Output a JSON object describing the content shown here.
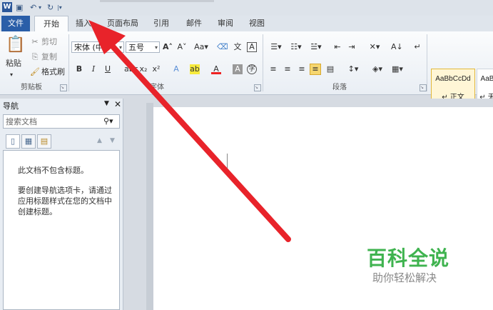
{
  "quick_access": {
    "word_icon": "word-logo",
    "save_icon": "save-icon",
    "undo": "↶",
    "redo": "↻"
  },
  "tabs": [
    {
      "label": "文件"
    },
    {
      "label": "开始"
    },
    {
      "label": "插入"
    },
    {
      "label": "页面布局"
    },
    {
      "label": "引用"
    },
    {
      "label": "邮件"
    },
    {
      "label": "审阅"
    },
    {
      "label": "视图"
    }
  ],
  "clipboard": {
    "paste": "粘贴",
    "cut": "剪切",
    "copy": "复制",
    "format_painter": "格式刷",
    "group": "剪贴板"
  },
  "font": {
    "name": "宋体 (中",
    "size": "五号",
    "group": "字体"
  },
  "paragraph": {
    "group": "段落"
  },
  "styles": {
    "normal_sample": "AaBbCcDd",
    "normal_name": "正文",
    "next_sample": "AaB",
    "next_name": "无"
  },
  "nav_pane": {
    "title": "导航",
    "search_placeholder": "搜索文档",
    "message_1": "此文档不包含标题。",
    "message_2_lines": [
      "要创建导航选项卡，请通过",
      "应用标题样式在您的文档中",
      "创建标题。"
    ]
  },
  "watermark": {
    "title": "百科全说",
    "subtitle": "助你轻松解决"
  },
  "colors": {
    "file_tab": "#2a5ea8",
    "arrow": "#e8232a",
    "watermark_green": "#3fb34f"
  }
}
